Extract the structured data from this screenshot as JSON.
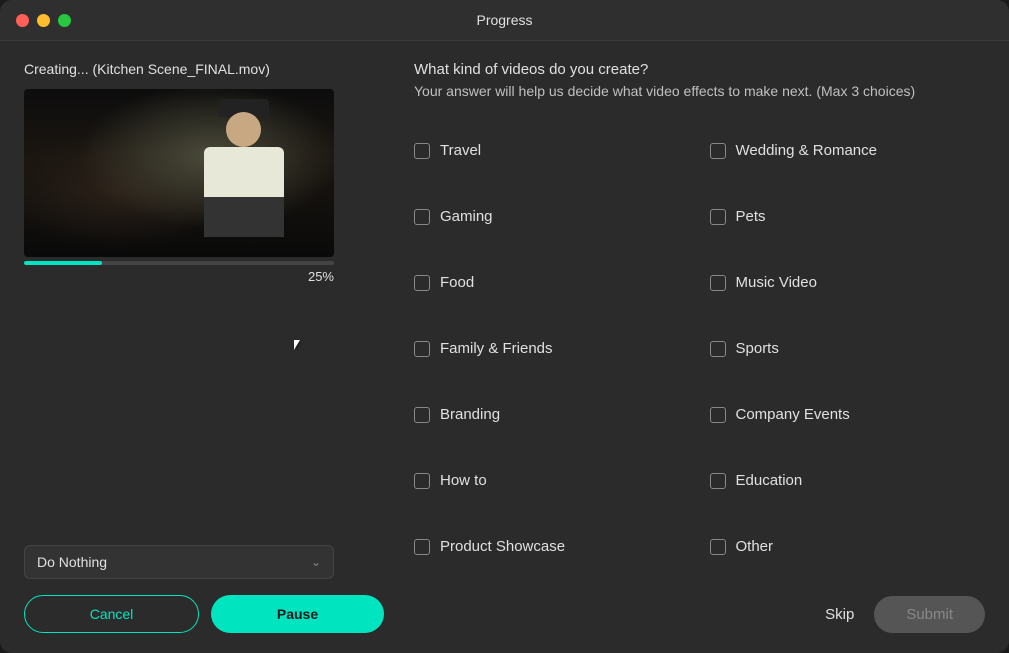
{
  "window": {
    "title": "Progress"
  },
  "left_panel": {
    "creating_label": "Creating... (Kitchen Scene_FINAL.mov)",
    "progress_percent": "25%",
    "dropdown_label": "Do Nothing",
    "btn_cancel_label": "Cancel",
    "btn_pause_label": "Pause"
  },
  "right_panel": {
    "survey_title": "What kind of videos do you create?",
    "survey_subtitle": "Your answer will help us decide what video effects to make next.  (Max 3 choices)",
    "checkboxes": [
      {
        "id": "travel",
        "label": "Travel",
        "column": 0
      },
      {
        "id": "gaming",
        "label": "Gaming",
        "column": 0
      },
      {
        "id": "food",
        "label": "Food",
        "column": 0
      },
      {
        "id": "family",
        "label": "Family & Friends",
        "column": 0
      },
      {
        "id": "branding",
        "label": "Branding",
        "column": 0
      },
      {
        "id": "howto",
        "label": "How to",
        "column": 0
      },
      {
        "id": "product",
        "label": "Product Showcase",
        "column": 0
      },
      {
        "id": "wedding",
        "label": "Wedding & Romance",
        "column": 1
      },
      {
        "id": "pets",
        "label": "Pets",
        "column": 1
      },
      {
        "id": "music",
        "label": "Music Video",
        "column": 1
      },
      {
        "id": "sports",
        "label": "Sports",
        "column": 1
      },
      {
        "id": "company",
        "label": "Company Events",
        "column": 1
      },
      {
        "id": "education",
        "label": "Education",
        "column": 1
      },
      {
        "id": "other",
        "label": "Other",
        "column": 1
      }
    ],
    "btn_skip_label": "Skip",
    "btn_submit_label": "Submit"
  },
  "colors": {
    "accent": "#00e5c0",
    "bg": "#2b2b2b",
    "text_primary": "#e0e0e0",
    "text_secondary": "#c0c0c0"
  }
}
